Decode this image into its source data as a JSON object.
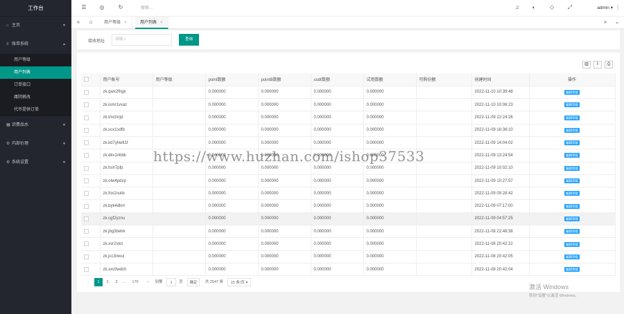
{
  "sidebar": {
    "brand": "工作台",
    "groups": [
      {
        "label": "主页",
        "icon": "home-icon"
      },
      {
        "label": "账单系统",
        "icon": "list-icon",
        "expanded": true,
        "items": [
          "用户等级",
          "用户列表",
          "订单接口",
          "庸阴裤改",
          "代币提供订单"
        ]
      },
      {
        "label": "识费品水",
        "icon": "grid-icon"
      },
      {
        "label": "内部价理",
        "icon": "settings-icon"
      },
      {
        "label": "系统设置",
        "icon": "gear-icon"
      }
    ]
  },
  "header": {
    "search_placeholder": "搜索...",
    "user": "admin"
  },
  "tabs": [
    "用户等级",
    "用户列表"
  ],
  "filter": {
    "label": "接收地址",
    "placeholder": "请输入",
    "button": "查询"
  },
  "table": {
    "headers": [
      "用户账号",
      "用户等级",
      "point数额",
      "pointB数额",
      "usdt数额",
      "试用数额",
      "可购份额",
      "创建时间",
      "操作"
    ],
    "action_label": "编辑等级",
    "rows": [
      {
        "account": "zk.qwx2fhgk",
        "point": "0.000000",
        "pointb": "0.000000",
        "usdt": "0.000000",
        "trial": "0.000000",
        "created": "2022-11-10 10:39:48"
      },
      {
        "account": "zk.ismr1vvaz",
        "point": "0.000000",
        "pointb": "0.000000",
        "usdt": "0.000000",
        "trial": "0.000000",
        "created": "2022-11-10 10:06:23"
      },
      {
        "account": "zk.tmcfxrjd",
        "point": "0.000000",
        "pointb": "0.000000",
        "usdt": "0.000000",
        "trial": "0.000000",
        "created": "2022-11-09 22:24:26"
      },
      {
        "account": "zk.scx1sdfb",
        "point": "0.000000",
        "pointb": "0.000000",
        "usdt": "0.000000",
        "trial": "0.000000",
        "created": "2022-11-09 16:36:10"
      },
      {
        "account": "zk.kd7yhwlt1f",
        "point": "0.000000",
        "pointb": "0.000000",
        "usdt": "0.000000",
        "trial": "0.000000",
        "created": "2022-11-09 14:04:02"
      },
      {
        "account": "zk.dkv1nbbk",
        "point": "0.000000",
        "pointb": "0.000000",
        "usdt": "0.000000",
        "trial": "0.000000",
        "created": "2022-11-09 13:24:54"
      },
      {
        "account": "zk.hsh7pfp",
        "point": "0.000000",
        "pointb": "0.000000",
        "usdt": "0.000000",
        "trial": "0.000000",
        "created": "2022-11-09 10:02:10"
      },
      {
        "account": "zk.otw4pdxp",
        "point": "0.000000",
        "pointb": "0.000000",
        "usdt": "0.000000",
        "trial": "0.000000",
        "created": "2022-11-09 10:27:57"
      },
      {
        "account": "zk.fnx2nutix",
        "point": "0.000000",
        "pointb": "0.000000",
        "usdt": "0.000000",
        "trial": "0.000000",
        "created": "2022-11-09 09:28:42"
      },
      {
        "account": "zk.byk4dkm",
        "point": "0.000000",
        "pointb": "0.000000",
        "usdt": "0.000000",
        "trial": "0.000000",
        "created": "2022-11-09 07:17:00"
      },
      {
        "account": "zk.cgf2yznu",
        "point": "0.000000",
        "pointb": "0.000000",
        "usdt": "0.000000",
        "trial": "0.000000",
        "created": "2022-11-09 04:57:25",
        "highlight": true
      },
      {
        "account": "zk.jbg3behk",
        "point": "0.000000",
        "pointb": "0.000000",
        "usdt": "0.000000",
        "trial": "0.000000",
        "created": "2022-11-08 22:48:38"
      },
      {
        "account": "zk.xvr2stol",
        "point": "0.000000",
        "pointb": "0.000000",
        "usdt": "0.000000",
        "trial": "0.000000",
        "created": "2022-11-08 20:42:22"
      },
      {
        "account": "zk.jcc3nwui",
        "point": "0.000000",
        "pointb": "0.000000",
        "usdt": "0.000000",
        "trial": "0.000000",
        "created": "2022-11-08 20:42:05"
      },
      {
        "account": "zk.xxv3wdch",
        "point": "0.000000",
        "pointb": "0.000000",
        "usdt": "0.000000",
        "trial": "0.000000",
        "created": "2022-11-08 20:42:04"
      }
    ]
  },
  "pager": {
    "current": "1",
    "pages": [
      "2",
      "3",
      "...",
      "170"
    ],
    "goto_label": "到第",
    "goto_value": "1",
    "page_unit": "页",
    "confirm": "确定",
    "total": "共 2547 条",
    "per_page": "15 条/页"
  },
  "watermark": "https://www.huzhan.com/ishop37533",
  "activation": {
    "title": "激活 Windows",
    "subtitle": "转到\"设置\"以激活 Windows。"
  },
  "colors": {
    "accent": "#009688",
    "sidebar": "#23262e",
    "tag": "#1e9fff"
  }
}
